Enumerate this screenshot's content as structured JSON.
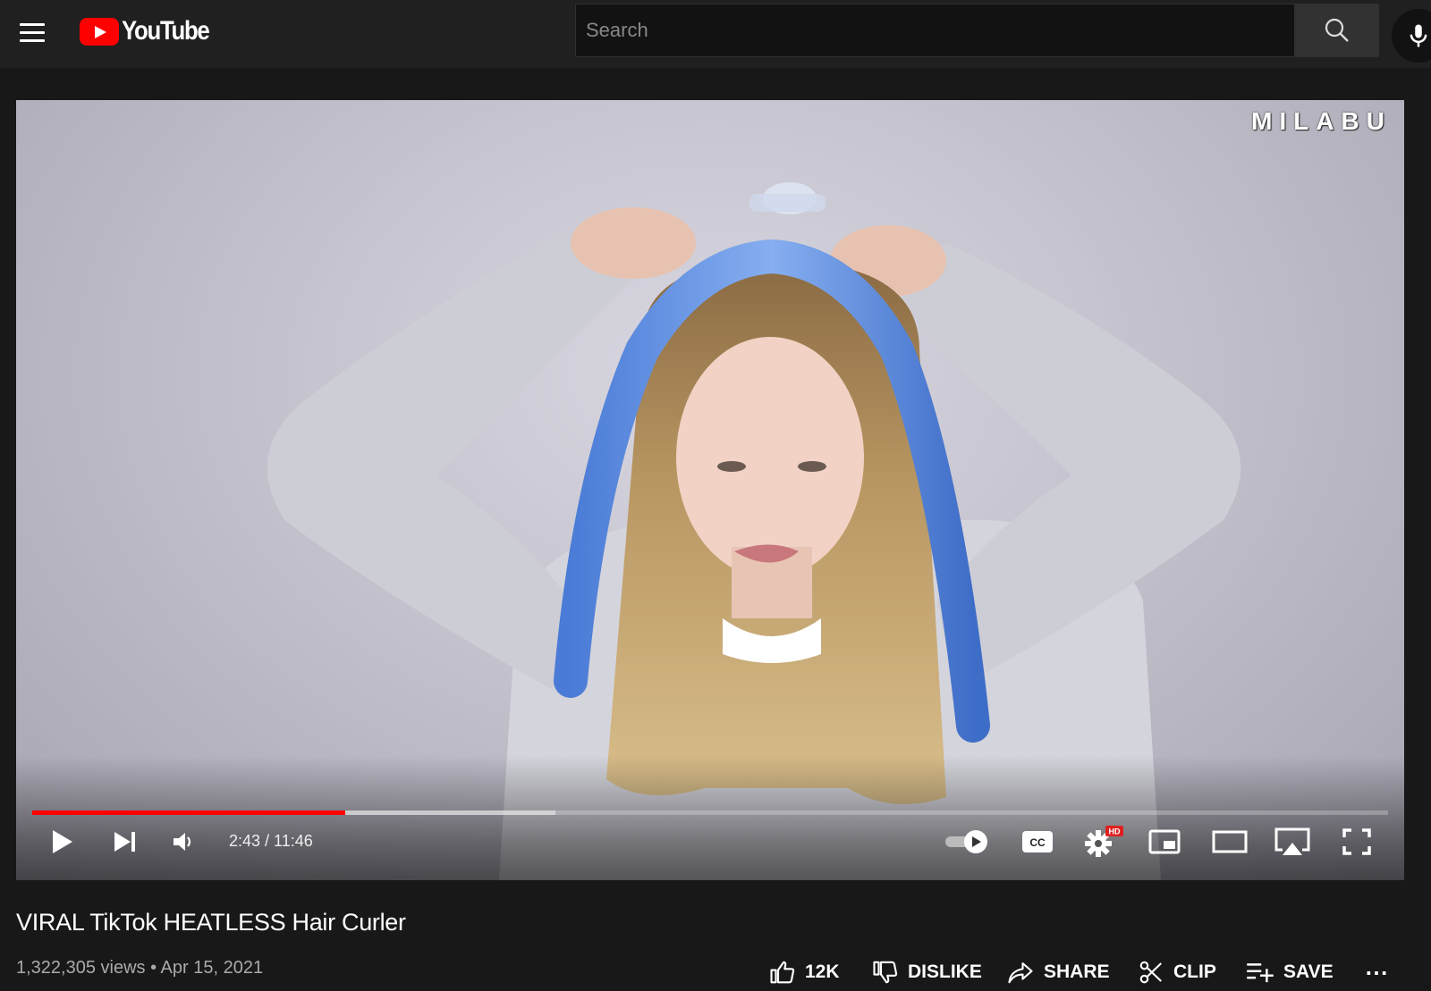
{
  "header": {
    "logo_text": "YouTube",
    "search_placeholder": "Search",
    "brand_color": "#ff0000"
  },
  "player": {
    "watermark": "MILABU",
    "current_time": "2:43",
    "duration": "11:46",
    "time_display": "2:43 / 11:46",
    "progress_fraction": 0.231,
    "buffered_fraction": 0.386,
    "progress_color": "#ff0000",
    "settings_badge": "HD",
    "controls": [
      "play-icon",
      "next-icon",
      "volume-icon",
      "autoplay-toggle-icon",
      "captions-icon",
      "settings-icon",
      "miniplayer-icon",
      "theater-icon",
      "airplay-icon",
      "fullscreen-icon"
    ]
  },
  "video": {
    "title": "VIRAL TikTok HEATLESS Hair Curler",
    "meta": "1,322,305 views • Apr 15, 2021"
  },
  "actions": {
    "like": "12K",
    "dislike": "DISLIKE",
    "share": "SHARE",
    "clip": "CLIP",
    "save": "SAVE",
    "more": "⋯"
  }
}
